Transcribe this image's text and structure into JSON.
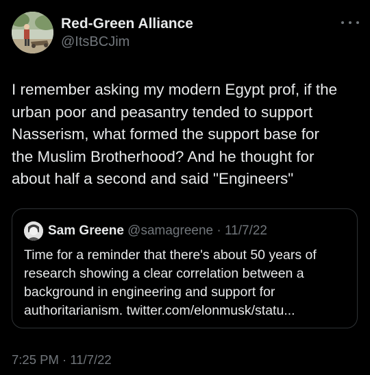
{
  "author": {
    "display_name": "Red-Green Alliance",
    "handle": "@ItsBCJim"
  },
  "tweet": {
    "text": "I remember asking my modern Egypt prof, if the\nurban poor and peasantry tended to support\nNasserism, what formed the support base for\nthe Muslim Brotherhood? And he thought for\nabout half a second and said \"Engineers\"",
    "timestamp": "7:25 PM · 11/7/22"
  },
  "quote": {
    "display_name": "Sam Greene",
    "meta": " @samagreene · 11/7/22",
    "text": "Time for a reminder that there's about 50 years of\nresearch showing a clear correlation between a\nbackground in engineering and support for\nauthoritarianism. twitter.com/elonmusk/statu..."
  },
  "icons": {
    "more": "more-horizontal-icon"
  },
  "colors": {
    "background": "#000000",
    "primary_text": "#e7e9ea",
    "secondary_text": "#71767b",
    "border": "#2f3336"
  }
}
